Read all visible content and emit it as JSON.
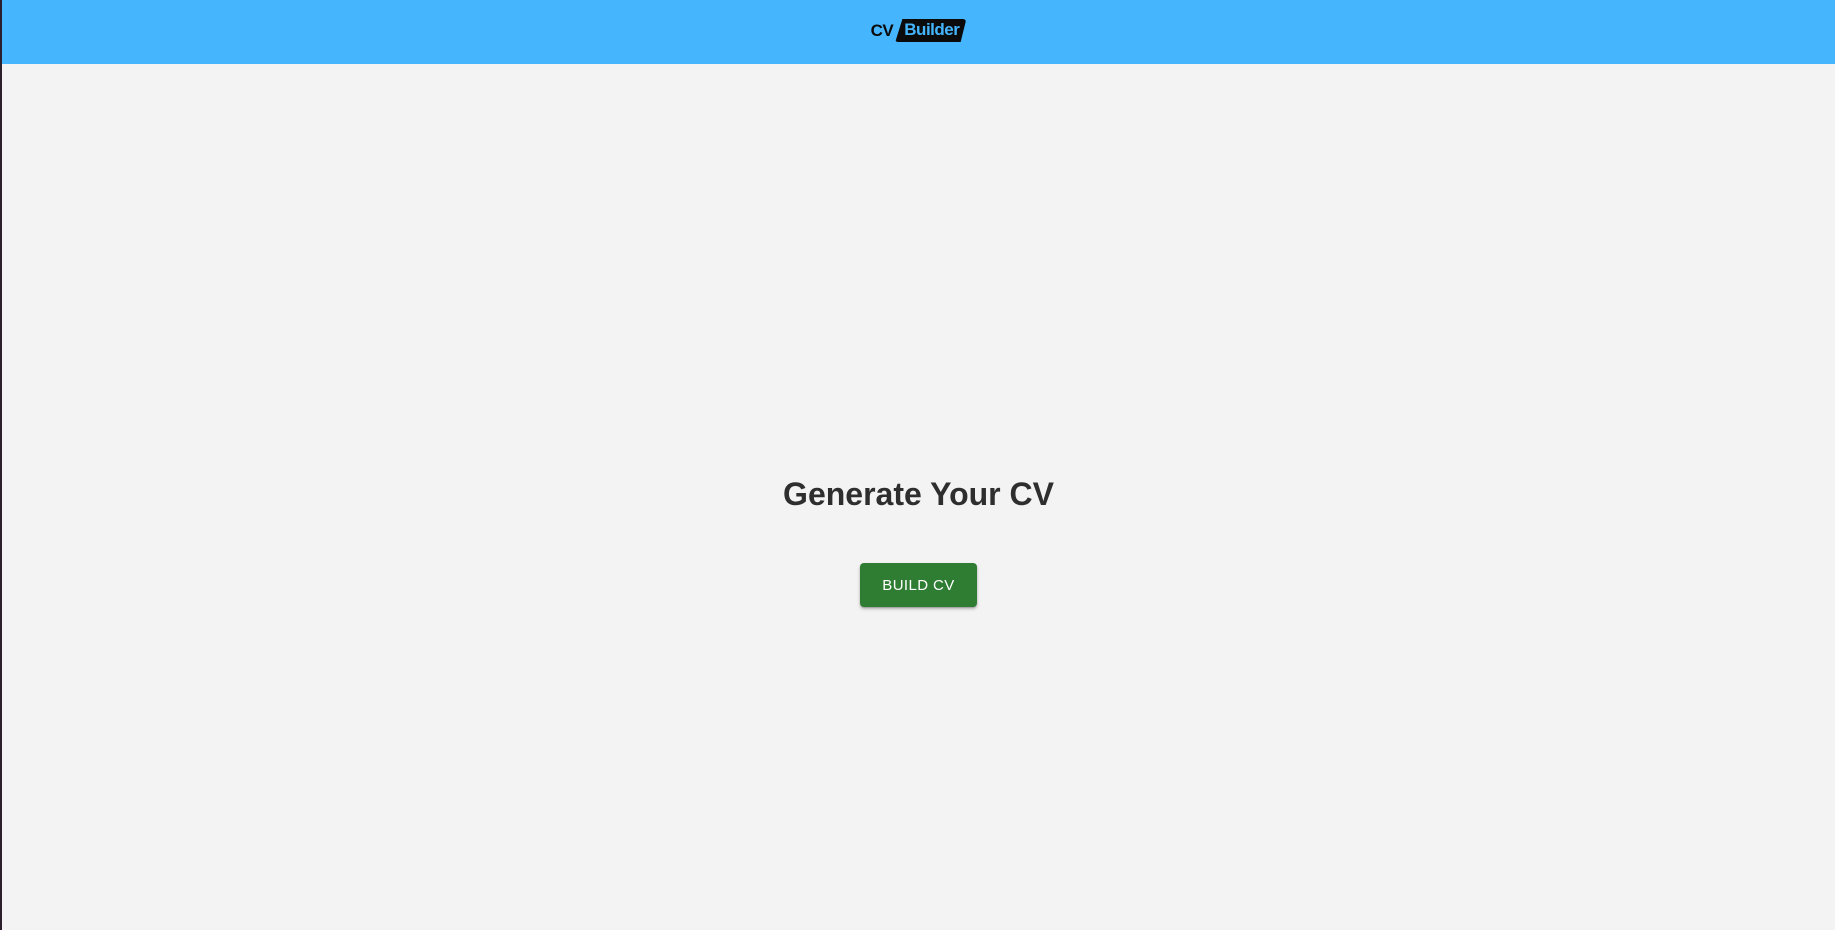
{
  "header": {
    "logo": {
      "cv_text": "CV",
      "builder_text": "Builder"
    }
  },
  "main": {
    "title": "Generate Your CV",
    "build_button_label": "BUILD CV"
  },
  "colors": {
    "header_bg": "#45b6fe",
    "page_bg": "#f3f3f3",
    "button_bg": "#2e7d32",
    "title_text": "#2e2e2e"
  }
}
